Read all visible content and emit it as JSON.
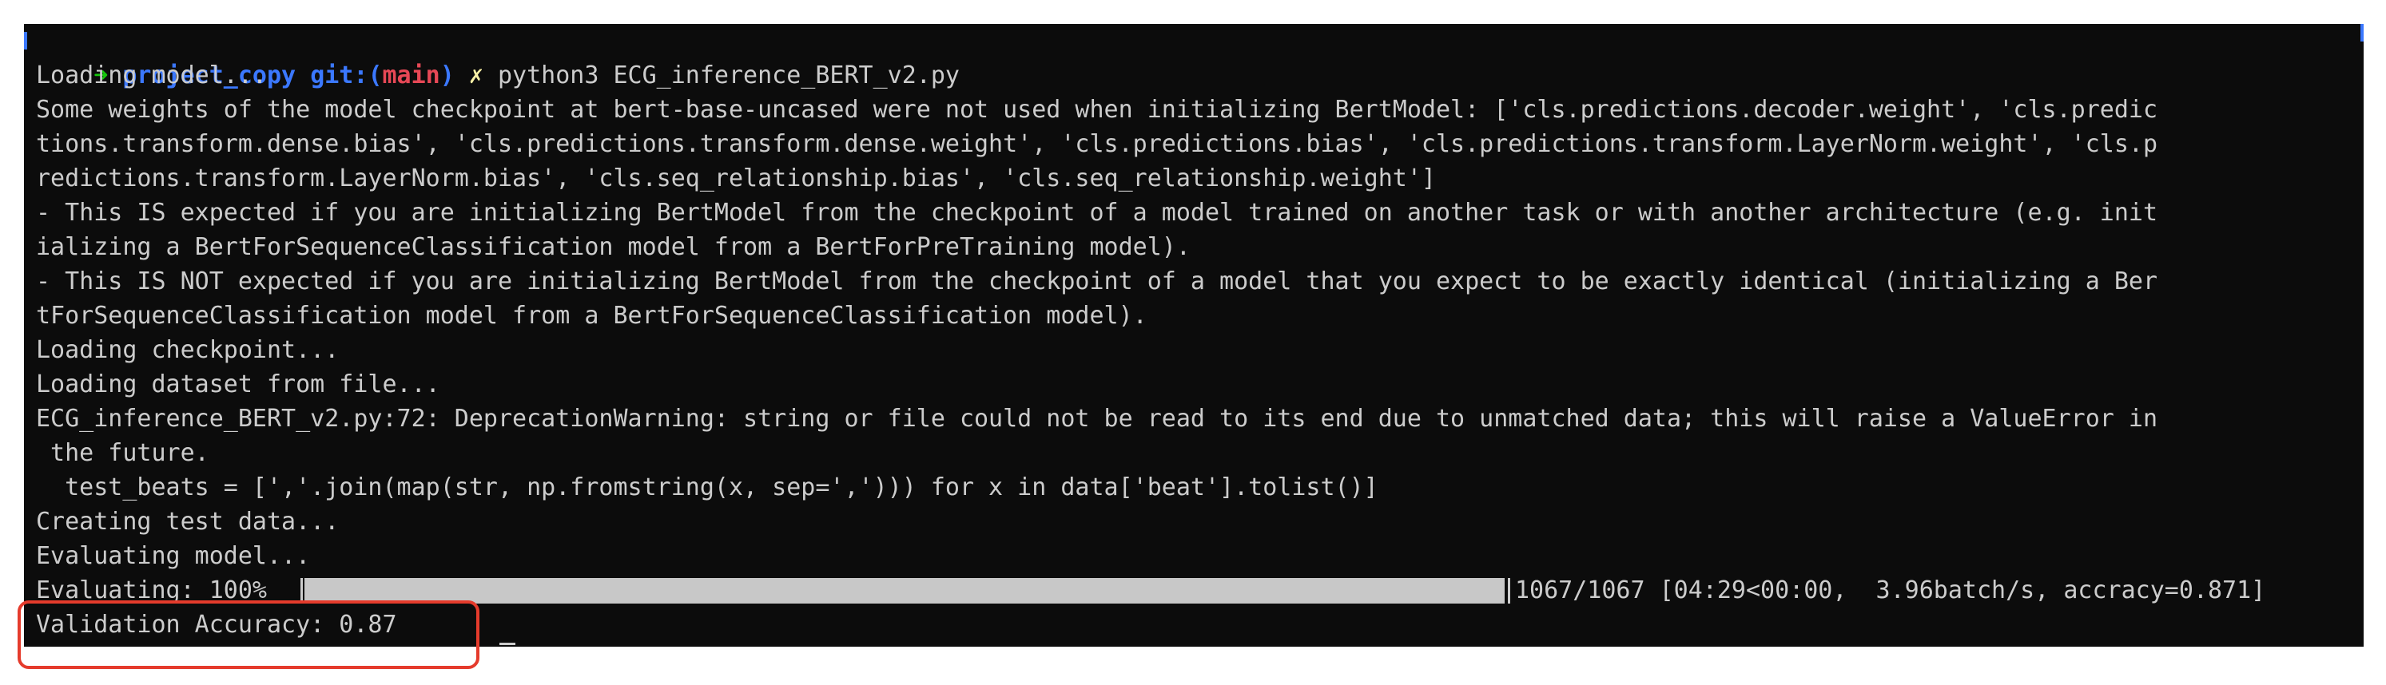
{
  "prompt": {
    "arrow": "➜",
    "directory": "project_copy",
    "git_label": "git:",
    "paren_open": "(",
    "branch": "main",
    "paren_close": ")",
    "dirty_mark": "✗",
    "command": "python3 ECG_inference_BERT_v2.py"
  },
  "output_lines": [
    "Loading model...",
    "Some weights of the model checkpoint at bert-base-uncased were not used when initializing BertModel: ['cls.predictions.decoder.weight', 'cls.predic",
    "tions.transform.dense.bias', 'cls.predictions.transform.dense.weight', 'cls.predictions.bias', 'cls.predictions.transform.LayerNorm.weight', 'cls.p",
    "redictions.transform.LayerNorm.bias', 'cls.seq_relationship.bias', 'cls.seq_relationship.weight']",
    "- This IS expected if you are initializing BertModel from the checkpoint of a model trained on another task or with another architecture (e.g. init",
    "ializing a BertForSequenceClassification model from a BertForPreTraining model).",
    "- This IS NOT expected if you are initializing BertModel from the checkpoint of a model that you expect to be exactly identical (initializing a Ber",
    "tForSequenceClassification model from a BertForSequenceClassification model).",
    "Loading checkpoint...",
    "Loading dataset from file...",
    "ECG_inference_BERT_v2.py:72: DeprecationWarning: string or file could not be read to its end due to unmatched data; this will raise a ValueError in",
    " the future.",
    "  test_beats = [','.join(map(str, np.fromstring(x, sep=','))) for x in data['beat'].tolist()]",
    "Creating test data...",
    "Evaluating model..."
  ],
  "progress": {
    "label": "Evaluating: 100%",
    "fraction": 1.0,
    "stats": "1067/1067 [04:29<00:00,  3.96batch/s, accracy=0.871]"
  },
  "result_line": "Validation Accuracy: 0.87",
  "colors": {
    "terminal_bg": "#0c0c0c",
    "text": "#cccccc",
    "arrow_green": "#16c60c",
    "path_blue": "#3b78ff",
    "branch_red": "#e74856",
    "dirty_yellow": "#f9f1a5",
    "highlight_red": "#e53b2c"
  }
}
